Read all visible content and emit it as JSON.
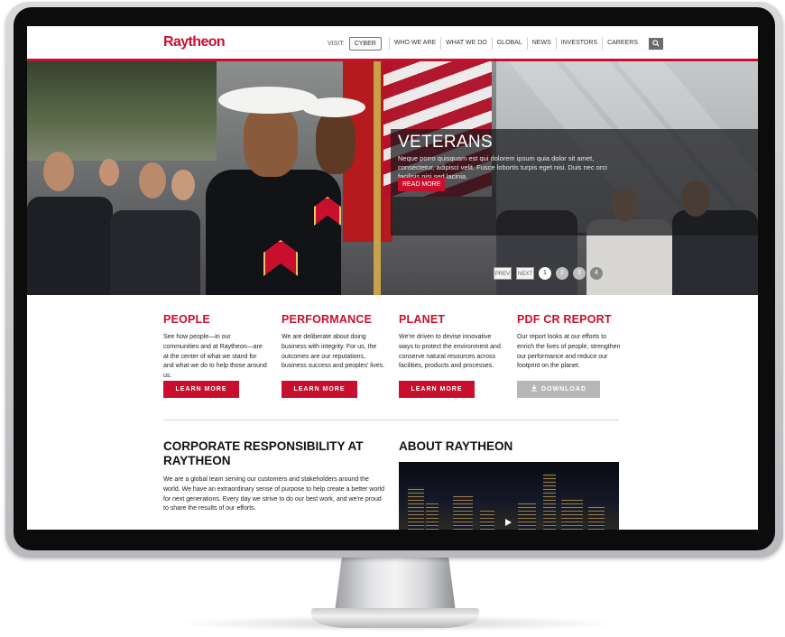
{
  "site": {
    "logo": "Raytheon",
    "nav": {
      "visit_label": "VISIT:",
      "cyber_label": "CYBER",
      "items": [
        {
          "label": "WHO WE ARE"
        },
        {
          "label": "WHAT WE DO"
        },
        {
          "label": "GLOBAL"
        },
        {
          "label": "NEWS"
        },
        {
          "label": "INVESTORS"
        },
        {
          "label": "CAREERS"
        }
      ],
      "search_icon": "search-icon"
    }
  },
  "hero": {
    "title": "VETERANS",
    "text": "Neque porro quisquam est qui dolorem ipsum quia dolor sit amet, consectetur, adipisci velit. Fusce lobortis turpis eget nisi. Duis nec orci facilisis nisi sed lacinia.",
    "button_label": "READ MORE",
    "pager": {
      "prev_label": "PREV",
      "next_label": "NEXT",
      "pages": [
        "1",
        "2",
        "3",
        "4"
      ],
      "active_page": "1"
    }
  },
  "features": [
    {
      "title": "PEOPLE",
      "text": "See how people—in our communities and at Raytheon—are at the center of what we stand for and what we do to help those around us.",
      "button_label": "LEARN MORE"
    },
    {
      "title": "PERFORMANCE",
      "text": "We are deliberate about doing business with integrity. For us, the outcomes are our reputations, business success and peoples' lives.",
      "button_label": "LEARN MORE"
    },
    {
      "title": "PLANET",
      "text": "We're driven to devise innovative ways to protect the environment and conserve natural resources across facilities, products and processes.",
      "button_label": "LEARN MORE"
    },
    {
      "title": "PDF CR REPORT",
      "text": "Our report looks at our efforts to enrich the lives of people, strengthen our performance and reduce our footprint on the planet.",
      "button_label": "DOWNLOAD",
      "button_icon": "download-icon"
    }
  ],
  "corporate": {
    "title": "CORPORATE RESPONSIBILITY AT RAYTHEON",
    "text": "We are a global team serving our customers and stakeholders around the world. We have an extraordinary sense of purpose to help create a better world for next generations. Every day we strive to do our best work, and we're proud to share the results of our efforts."
  },
  "about": {
    "title": "ABOUT RAYTHEON",
    "video_icon": "play-icon"
  },
  "colors": {
    "brand_red": "#c8102e",
    "button_grey": "#b7b7b7",
    "bezel": "#0c0c0d"
  }
}
